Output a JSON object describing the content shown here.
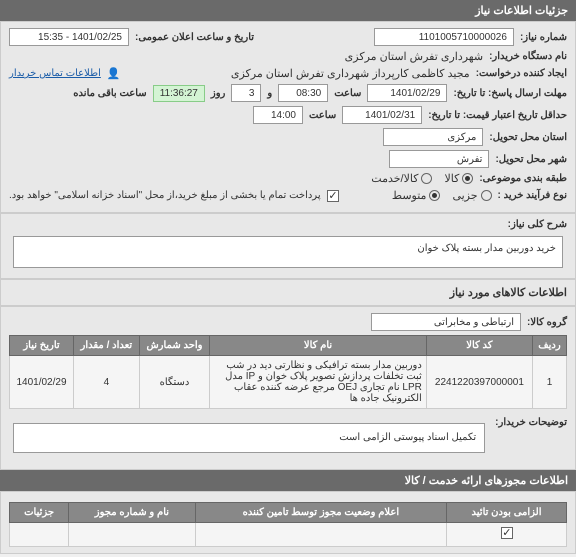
{
  "headers": {
    "main": "جزئیات اطلاعات نیاز",
    "goods_info": "اطلاعات کالاهای مورد نیاز",
    "permits": "اطلاعات مجوزهای ارائه خدمت / کالا"
  },
  "labels": {
    "need_number": "شماره نیاز:",
    "public_date": "تاریخ و ساعت اعلان عمومی:",
    "buyer_name": "نام دستگاه خریدار:",
    "requester": "ایجاد کننده درخواست:",
    "contact_link": "اطلاعات تماس خریدار",
    "response_deadline": "مهلت ارسال پاسخ: تا تاریخ:",
    "hour": "ساعت",
    "day": "و",
    "day_unit": "روز",
    "remaining": "ساعت باقی مانده",
    "validity_min": "حداقل تاریخ اعتبار قیمت: تا تاریخ:",
    "exec_province": "استان محل تحویل:",
    "exec_city": "شهر محل تحویل:",
    "classification": "طبقه بندی موضوعی:",
    "goods": "کالا",
    "service": "کالا/خدمت",
    "purchase_type": "نوع فرآیند خرید :",
    "small": "جزیی",
    "medium": "متوسط",
    "payment_note": "پرداخت تمام یا بخشی از مبلغ خرید،از محل \"اسناد خزانه اسلامی\" خواهد بود.",
    "need_desc": "شرح کلی نیاز:",
    "goods_group": "گروه کالا:",
    "buyer_notes": "توضیحات خریدار:",
    "mandatory": "الزامی بودن تائید",
    "permit_status": "اعلام وضعیت مجوز توسط تامین کننده",
    "details": "جزئیات"
  },
  "values": {
    "need_number": "1101005710000026",
    "public_date": "1401/02/25 - 15:35",
    "buyer_name": "شهرداری تفرش استان مرکزی",
    "requester": "مجید کاظمی کارپرداز شهرداری تفرش استان مرکزی",
    "response_date": "1401/02/29",
    "response_hour": "08:30",
    "response_days": "3",
    "remaining_time": "11:36:27",
    "validity_date": "1401/02/31",
    "validity_hour": "14:00",
    "exec_province": "مرکزی",
    "exec_city": "تفرش",
    "need_desc": "خرید دوربین مدار بسته پلاک خوان",
    "goods_group": "ارتباطی و مخابراتی",
    "buyer_notes": "تکمیل اسناد پیوستی الزامی است"
  },
  "table": {
    "headers": {
      "row": "ردیف",
      "code": "کد کالا",
      "name": "نام کالا",
      "unit": "واحد شمارش",
      "qty": "تعداد / مقدار",
      "date": "تاریخ نیاز"
    },
    "rows": [
      {
        "row": "1",
        "code": "2241220397000001",
        "name": "دوربین مدار بسته ترافیکی و نظارتی دید در شب ثبت تخلفات پردازش تصویر پلاک خوان و IP مدل LPR نام تجاری OEJ مرجع عرضه کننده عقاب الکترونیک جاده ها",
        "unit": "دستگاه",
        "qty": "4",
        "date": "1401/02/29"
      }
    ]
  },
  "bottom_table": {
    "col_attach": "نام و شماره مجوز"
  }
}
